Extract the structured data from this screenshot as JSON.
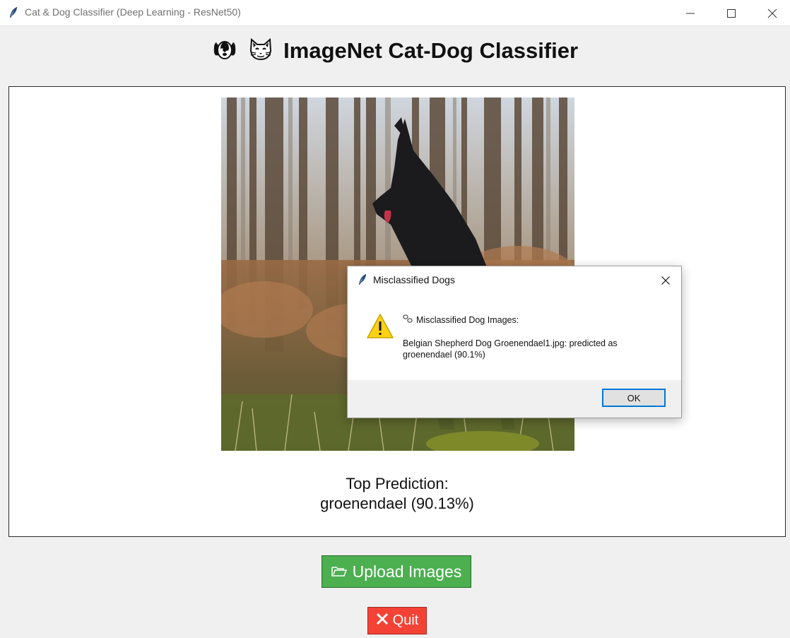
{
  "window": {
    "title": "Cat & Dog Classifier (Deep Learning - ResNet50)",
    "icon": "feather-icon"
  },
  "header": {
    "title": "ImageNet Cat-Dog Classifier",
    "icons": [
      "dog-face-icon",
      "cat-face-icon"
    ]
  },
  "image": {
    "subject": "dog-photo"
  },
  "prediction": {
    "line1": "Top Prediction:",
    "line2": "groenendael (90.13%)"
  },
  "buttons": {
    "upload_label": "Upload Images",
    "upload_icon": "folder-icon",
    "upload_color": "#4caf50",
    "quit_label": "Quit",
    "quit_icon": "close-x-icon",
    "quit_color": "#f44336"
  },
  "dialog": {
    "title": "Misclassified Dogs",
    "heading": "Misclassified Dog Images:",
    "body": "Belgian Shepherd Dog Groenendael1.jpg: predicted as groenendael (90.1%)",
    "ok_label": "OK",
    "icon": "warning-icon"
  }
}
